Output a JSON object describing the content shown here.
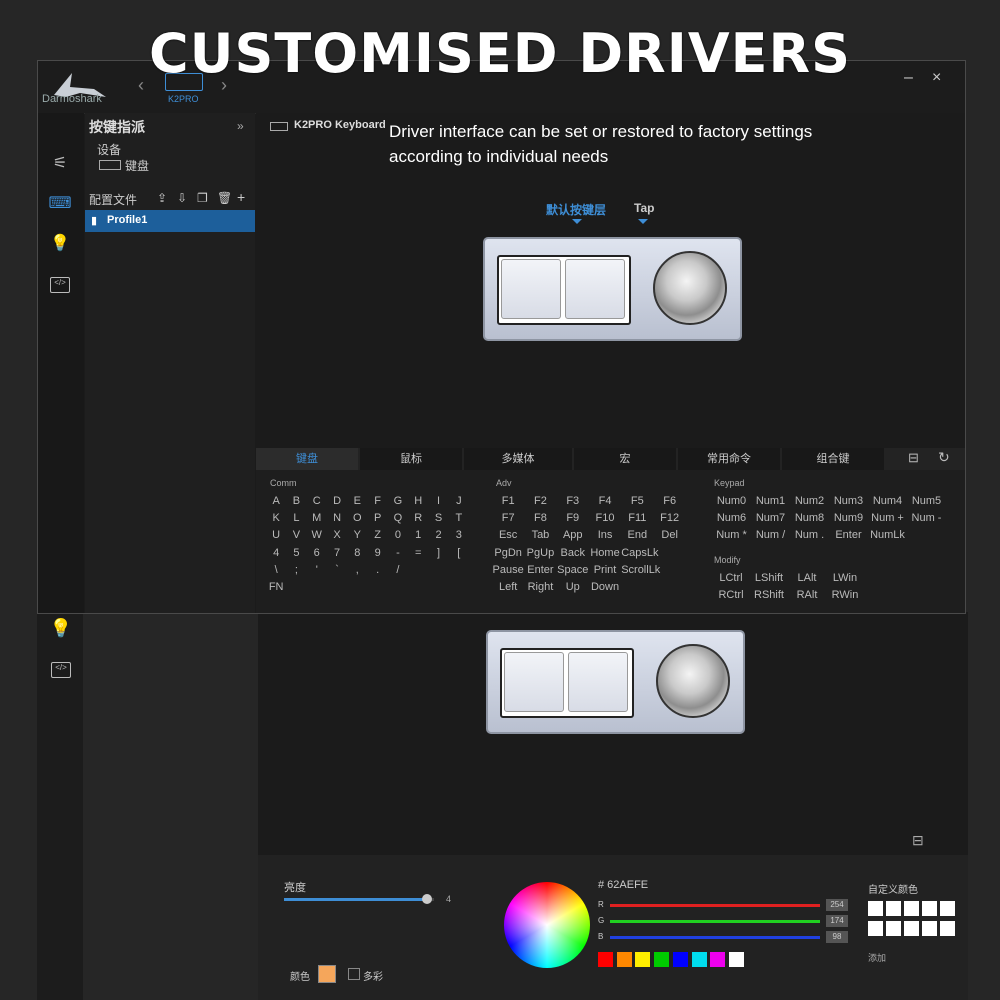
{
  "headline": "CUSTOMISED DRIVERS",
  "window": {
    "brand": "Darmoshark",
    "device_label": "K2PRO",
    "minimize": "–",
    "close": "×",
    "nav_prev": "‹",
    "nav_next": "›",
    "panel_title": "按键指派",
    "collapse": "»",
    "device_section": "设备",
    "device_item": "键盘",
    "profiles_label": "配置文件",
    "profile_name": "Profile1",
    "device_name": "K2PRO Keyboard",
    "description": "Driver interface can be set or restored to factory settings according to individual needs",
    "layer_tabs": [
      "默认按键层",
      "Tap"
    ],
    "key_tabs": [
      "键盘",
      "鼠标",
      "多媒体",
      "宏",
      "常用命令",
      "组合键"
    ],
    "sections": {
      "comm": "Comm",
      "adv": "Adv",
      "keypad": "Keypad",
      "modify": "Modify"
    },
    "comm_rows": [
      [
        "A",
        "B",
        "C",
        "D",
        "E",
        "F",
        "G",
        "H",
        "I",
        "J"
      ],
      [
        "K",
        "L",
        "M",
        "N",
        "O",
        "P",
        "Q",
        "R",
        "S",
        "T"
      ],
      [
        "U",
        "V",
        "W",
        "X",
        "Y",
        "Z",
        "0",
        "1",
        "2",
        "3"
      ],
      [
        "4",
        "5",
        "6",
        "7",
        "8",
        "9",
        "-",
        "=",
        "]",
        "["
      ],
      [
        "\\",
        ";",
        "'",
        "`",
        ",",
        ".",
        "/"
      ],
      [
        "FN"
      ]
    ],
    "adv_rows": [
      [
        "F1",
        "F2",
        "F3",
        "F4",
        "F5",
        "F6"
      ],
      [
        "F7",
        "F8",
        "F9",
        "F10",
        "F11",
        "F12"
      ],
      [
        "Esc",
        "Tab",
        "App",
        "Ins",
        "End",
        "Del"
      ],
      [
        "PgDn",
        "PgUp",
        "Back",
        "Home",
        "CapsLk"
      ],
      [
        "Pause",
        "Enter",
        "Space",
        "Print",
        "ScrollLk"
      ],
      [
        "Left",
        "Right",
        "Up",
        "Down"
      ]
    ],
    "keypad_rows": [
      [
        "Num0",
        "Num1",
        "Num2",
        "Num3",
        "Num4",
        "Num5"
      ],
      [
        "Num6",
        "Num7",
        "Num8",
        "Num9",
        "Num +",
        "Num -"
      ],
      [
        "Num *",
        "Num /",
        "Num .",
        "Enter",
        "NumLk"
      ]
    ],
    "modify_rows": [
      [
        "LCtrl",
        "LShift",
        "LAlt",
        "LWin"
      ],
      [
        "RCtrl",
        "RShift",
        "RAlt",
        "RWin"
      ]
    ]
  },
  "lighting": {
    "brightness_label": "亮度",
    "brightness_value": "4",
    "brightness_fraction": 0.95,
    "hex": "# 62AEFE",
    "r_label": "R",
    "g_label": "G",
    "b_label": "B",
    "r_value": "254",
    "g_value": "174",
    "b_value": "98",
    "color_label": "颜色",
    "multicolor_label": "多彩",
    "custom_label": "自定义颜色",
    "add_label": "添加",
    "preset_colors": [
      "#ff0000",
      "#ff8800",
      "#ffee00",
      "#00cc00",
      "#0000ff",
      "#00ddee",
      "#ee00ee",
      "#ffffff"
    ],
    "current_color": "#f5a65b"
  }
}
